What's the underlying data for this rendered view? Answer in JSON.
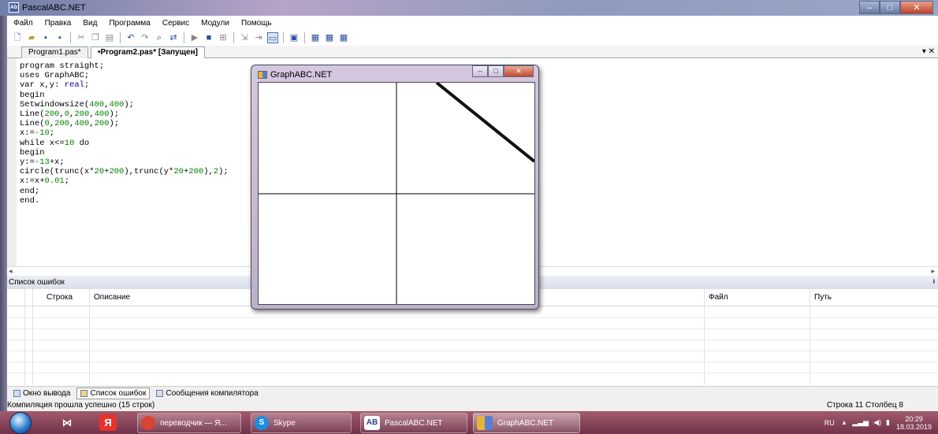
{
  "window": {
    "title": "PascalABC.NET",
    "icon": "PascalABC",
    "controls": {
      "minimize": "–",
      "maximize": "□",
      "close": "✕"
    }
  },
  "menu": [
    "Файл",
    "Правка",
    "Вид",
    "Программа",
    "Сервис",
    "Модули",
    "Помощь"
  ],
  "toolbar_icons": [
    "new-icon",
    "open-icon",
    "save-icon",
    "save-all-icon",
    "cut-icon",
    "copy-icon",
    "paste-icon",
    "undo-icon",
    "redo-icon",
    "find-icon",
    "replace-icon",
    "run-icon",
    "stop-icon",
    "debug-icon",
    "step-into-icon",
    "step-over-icon",
    "form-icon",
    "compile-icon",
    "watch1-icon",
    "watch2-icon",
    "watch3-icon"
  ],
  "tabs": [
    {
      "label": "Program1.pas*"
    },
    {
      "label": "•Program2.pas* [Запущен]"
    }
  ],
  "tabs_dropdown": "▾ ✕",
  "code_lines": [
    [
      {
        "t": "program straight;",
        "c": "kw"
      }
    ],
    [
      {
        "t": "uses GraphABC;",
        "c": "kw"
      }
    ],
    [
      {
        "t": "var x,y: ",
        "c": "kw"
      },
      {
        "t": "real",
        "c": "ty"
      },
      {
        "t": ";",
        "c": "kw"
      }
    ],
    [
      {
        "t": "begin",
        "c": "kw"
      }
    ],
    [
      {
        "t": "Setwindowsize(",
        "c": "kw"
      },
      {
        "t": "400",
        "c": "num"
      },
      {
        "t": ",",
        "c": "kw"
      },
      {
        "t": "400",
        "c": "num"
      },
      {
        "t": ");",
        "c": "kw"
      }
    ],
    [
      {
        "t": "Line(",
        "c": "kw"
      },
      {
        "t": "200",
        "c": "num"
      },
      {
        "t": ",",
        "c": "kw"
      },
      {
        "t": "0",
        "c": "num"
      },
      {
        "t": ",",
        "c": "kw"
      },
      {
        "t": "200",
        "c": "num"
      },
      {
        "t": ",",
        "c": "kw"
      },
      {
        "t": "400",
        "c": "num"
      },
      {
        "t": ");",
        "c": "kw"
      }
    ],
    [
      {
        "t": "Line(",
        "c": "kw"
      },
      {
        "t": "0",
        "c": "num"
      },
      {
        "t": ",",
        "c": "kw"
      },
      {
        "t": "200",
        "c": "num"
      },
      {
        "t": ",",
        "c": "kw"
      },
      {
        "t": "400",
        "c": "num"
      },
      {
        "t": ",",
        "c": "kw"
      },
      {
        "t": "200",
        "c": "num"
      },
      {
        "t": ");",
        "c": "kw"
      }
    ],
    [
      {
        "t": "x:=",
        "c": "kw"
      },
      {
        "t": "-10",
        "c": "num"
      },
      {
        "t": ";",
        "c": "kw"
      }
    ],
    [
      {
        "t": "while x<=",
        "c": "kw"
      },
      {
        "t": "10",
        "c": "num"
      },
      {
        "t": " do",
        "c": "kw"
      }
    ],
    [
      {
        "t": "begin",
        "c": "kw"
      }
    ],
    [
      {
        "t": "y:=",
        "c": "kw"
      },
      {
        "t": "-13",
        "c": "num"
      },
      {
        "t": "+x;",
        "c": "kw"
      }
    ],
    [
      {
        "t": "circle(trunc(x*",
        "c": "kw"
      },
      {
        "t": "20",
        "c": "num"
      },
      {
        "t": "+",
        "c": "kw"
      },
      {
        "t": "200",
        "c": "num"
      },
      {
        "t": "),trunc(y*",
        "c": "kw"
      },
      {
        "t": "20",
        "c": "num"
      },
      {
        "t": "+",
        "c": "kw"
      },
      {
        "t": "200",
        "c": "num"
      },
      {
        "t": "),",
        "c": "kw"
      },
      {
        "t": "2",
        "c": "num"
      },
      {
        "t": ");",
        "c": "kw"
      }
    ],
    [
      {
        "t": "x:=x+",
        "c": "kw"
      },
      {
        "t": "0.01",
        "c": "num"
      },
      {
        "t": ";",
        "c": "kw"
      }
    ],
    [
      {
        "t": "end;",
        "c": "kw"
      }
    ],
    [
      {
        "t": "end.",
        "c": "kw"
      }
    ]
  ],
  "hscroll": {
    "left": "◂",
    "right": "▸"
  },
  "error_panel": {
    "title": "Список ошибок",
    "pin": "ᵻ",
    "columns": {
      "line": "Строка",
      "description": "Описание",
      "file": "Файл",
      "path": "Путь"
    }
  },
  "bottom_tabs": [
    {
      "label": "Окно вывода"
    },
    {
      "label": "Список ошибок"
    },
    {
      "label": "Сообщения компилятора"
    }
  ],
  "status": {
    "left": "Компиляция прошла успешно (15 строк)",
    "right": "Строка  11  Столбец  8"
  },
  "graph_window": {
    "title": "GraphABC.NET",
    "controls": {
      "minimize": "–",
      "maximize": "□",
      "close": "✕"
    }
  },
  "taskbar": {
    "tasks": [
      {
        "label": "переводчик — Я...",
        "icon": "chrome-icon",
        "color": "#d94436"
      },
      {
        "label": "Skype",
        "icon": "skype-icon",
        "color": "#1d8de0"
      },
      {
        "label": "PascalABC.NET",
        "icon": "pascalabc-icon",
        "color": "#ffffff"
      },
      {
        "label": "GraphABC.NET",
        "icon": "graphabc-icon",
        "color": "#e8b33a"
      }
    ],
    "tray": {
      "lang": "RU",
      "time": "20:29",
      "date": "18.03.2019"
    }
  }
}
